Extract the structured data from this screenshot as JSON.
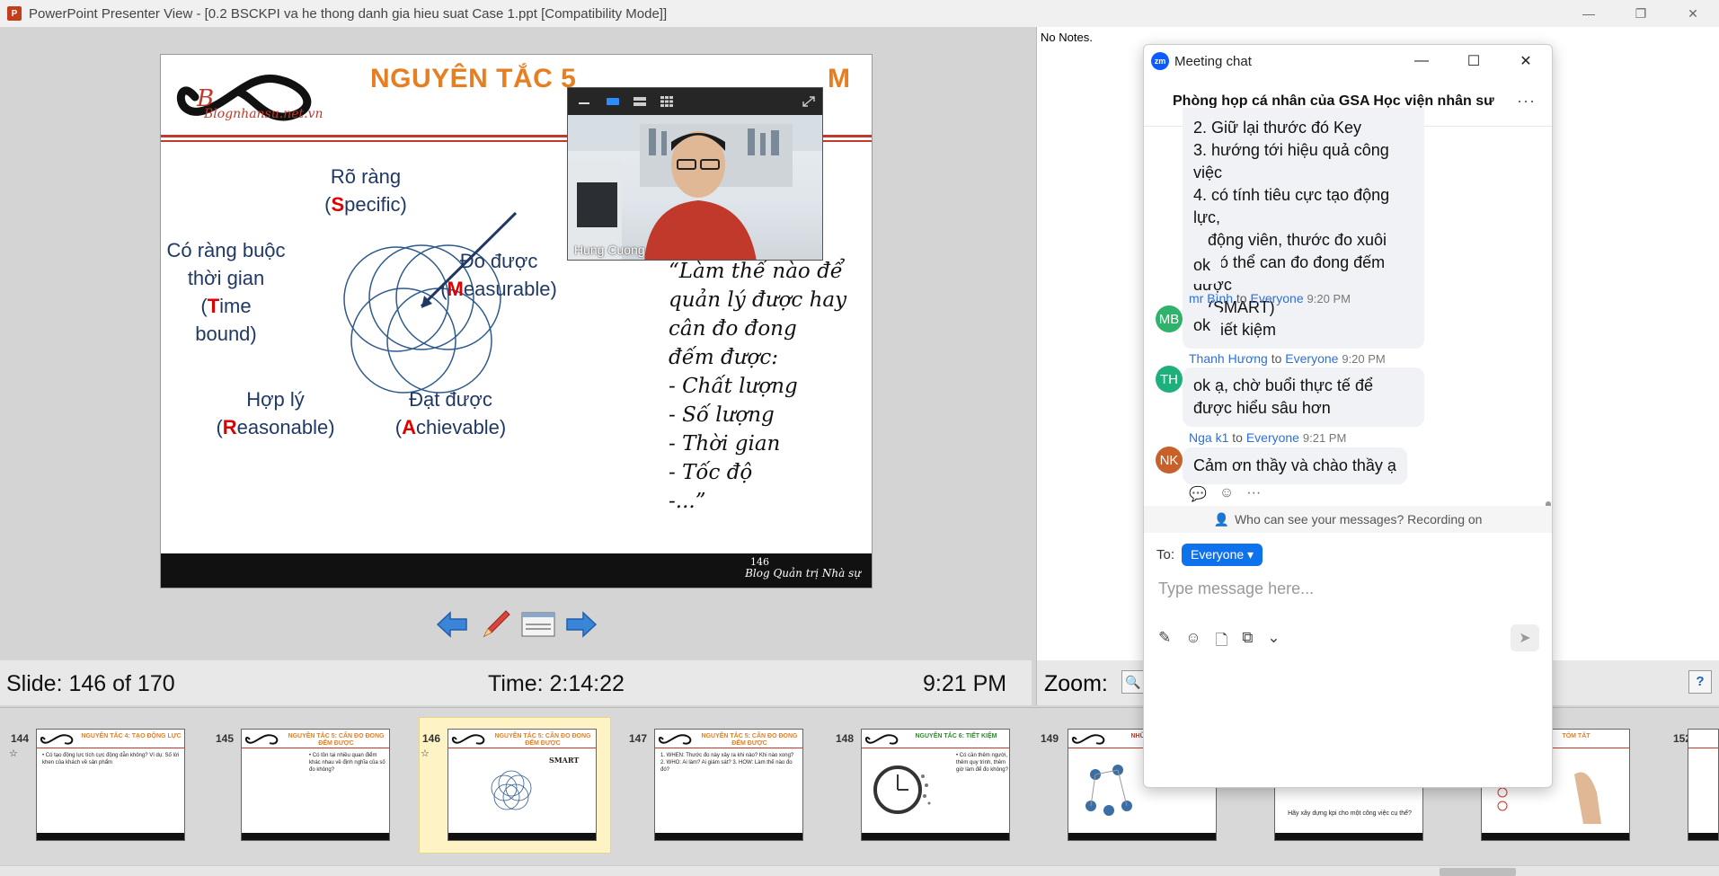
{
  "window": {
    "title": "PowerPoint Presenter View - [0.2 BSCKPI va he thong danh gia hieu suat Case 1.ppt [Compatibility Mode]]",
    "minimize": "—",
    "restore": "❐",
    "close": "✕"
  },
  "notes": {
    "text": "No Notes."
  },
  "slide": {
    "logo_text": "Blognhansu.net.vn",
    "title": "NGUYÊN TẮC 5",
    "title_tail": "M",
    "labels": {
      "specific": [
        "Rõ ràng",
        "(",
        "S",
        "pecific)"
      ],
      "measurable": [
        "Đo được",
        "(",
        "M",
        "easurable)"
      ],
      "timebound": [
        "Có ràng buộc",
        "thời gian (",
        "T",
        "ime",
        "bound)"
      ],
      "reasonable": [
        "Hợp lý",
        "(",
        "R",
        "easonable)"
      ],
      "achievable": [
        "Đạt được",
        "(",
        "A",
        "chievable)"
      ]
    },
    "quote_lines": [
      "“Làm thế nào để",
      "quản lý được hay",
      "cân đo đong",
      "đếm được:",
      "- Chất lượng",
      "- Số lượng",
      "- Thời gian",
      "- Tốc độ",
      "-...”"
    ],
    "page_number": "146",
    "footer_text": "Blog Quản trị Nhà sự"
  },
  "video": {
    "participant_name": "Hung Cuong"
  },
  "status": {
    "slide_counter": "Slide: 146 of 170",
    "elapsed_time": "Time: 2:14:22",
    "clock": "9:21 PM",
    "zoom_label": "Zoom:",
    "help": "?"
  },
  "thumbnails": [
    {
      "num": "144",
      "title": "NGUYÊN TẮC 4: TẠO ĐỘNG LỰC",
      "body": "• Có tạo động lực tích cực động dẫn không? Ví dụ: Số lời khen của khách về sản phẩm",
      "selected": false
    },
    {
      "num": "145",
      "title": "NGUYÊN TẮC 5: CÂN ĐO ĐONG ĐẾM ĐƯỢC",
      "body": "• Có tồn tại nhiều quan điểm khác nhau về định nghĩa của số đo không?",
      "selected": false
    },
    {
      "num": "146",
      "title": "NGUYÊN TẮC 5: CÂN ĐO ĐONG ĐẾM ĐƯỢC",
      "body": "SMART",
      "selected": true
    },
    {
      "num": "147",
      "title": "NGUYÊN TẮC 5: CÂN ĐO ĐONG ĐẾM ĐƯỢC",
      "body": "1. WHEN: Thước đo này xảy ra khi nào? Khi nào xong? 2. WHO: Ai làm? Ai giám sát? 3. HOW: Làm thế nào đo đó?",
      "selected": false
    },
    {
      "num": "148",
      "title": "NGUYÊN TẮC 6: TIẾT KIỆM",
      "body": "• Có cần thêm người, thêm quy trình, thêm giờ làm để đo không?",
      "selected": false
    },
    {
      "num": "149",
      "title": "NHỮN",
      "body": "",
      "selected": false
    },
    {
      "num": "150",
      "title": "",
      "body": "Hãy xây dựng kpi cho một công việc cụ thể?",
      "selected": false
    },
    {
      "num": "151",
      "title": "TÓM TẮT",
      "body": "",
      "selected": false
    },
    {
      "num": "152",
      "title": "",
      "body": "",
      "selected": false
    }
  ],
  "chat": {
    "window_title": "Meeting chat",
    "room_name": "Phòng họp cá nhân của GSA Học viện nhân sư",
    "list_items": [
      "2. Giữ lại thước đó Key",
      "3. hướng tới hiệu quả công việc",
      "4. có tính tiêu cực tạo động lực,",
      "    động viên, thước đo xuôi",
      "5. có thể can đo đong đếm được",
      "    (SMART)",
      "6. Tiết kiệm"
    ],
    "messages": [
      {
        "text": "ok"
      },
      {
        "initials": "MB",
        "sender": "mr Bình",
        "to": "to",
        "target": "Everyone",
        "time": "9:20 PM",
        "text": "ok",
        "color": "#2fb36a"
      },
      {
        "initials": "TH",
        "sender": "Thanh Hương",
        "to": "to",
        "target": "Everyone",
        "time": "9:20 PM",
        "text": "ok ạ, chờ buổi thực tế để được hiểu sâu hơn",
        "color": "#1db07b"
      },
      {
        "initials": "NK",
        "sender": "Nga k1",
        "to": "to",
        "target": "Everyone",
        "time": "9:21 PM",
        "text": "Cảm ơn thầy và chào thầy ạ",
        "color": "#c8602a"
      }
    ],
    "privacy_text": "Who can see your messages? Recording on",
    "to_label": "To:",
    "to_value": "Everyone",
    "input_placeholder": "Type message here..."
  },
  "colors": {
    "accent": "#0e72ed",
    "slide_title": "#e67e22",
    "slide_text": "#1f3864",
    "letter_highlight": "#e00000"
  }
}
